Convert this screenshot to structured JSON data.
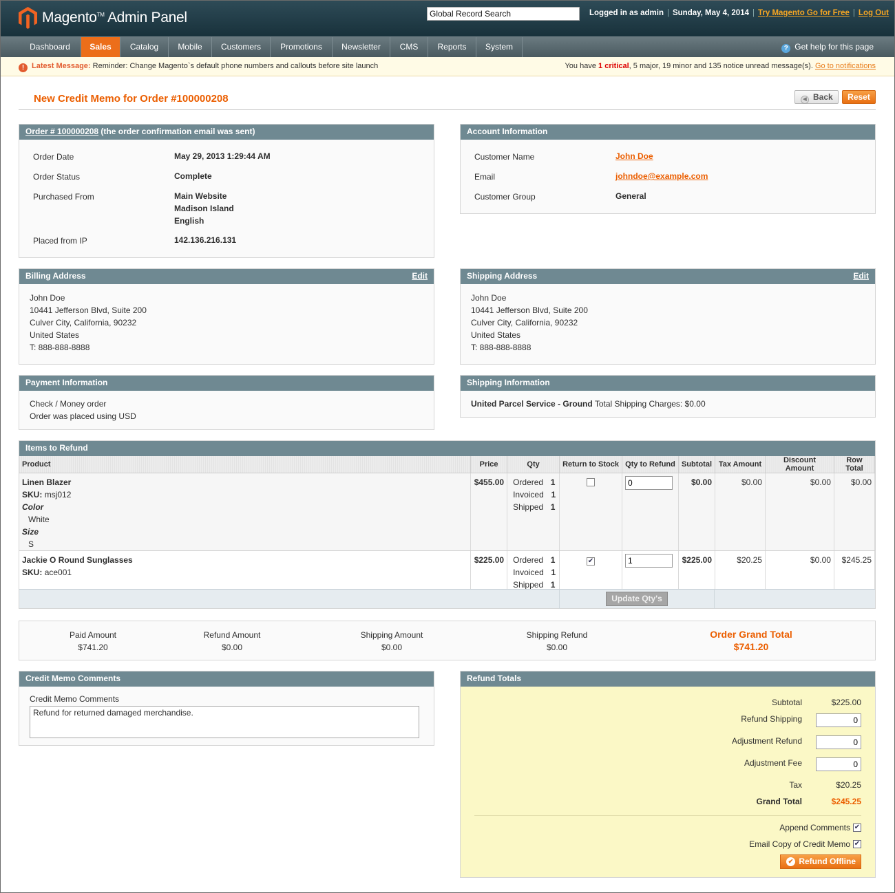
{
  "header": {
    "app_title": "Magento",
    "app_title_tm": "TM",
    "app_subtitle": "Admin Panel",
    "search_value": "Global Record Search",
    "logged_in": "Logged in as admin",
    "date": "Sunday, May 4, 2014",
    "try_link": "Try Magento Go for Free",
    "logout": "Log Out",
    "separator": "|"
  },
  "nav": {
    "items": [
      {
        "label": "Dashboard"
      },
      {
        "label": "Sales",
        "active": true
      },
      {
        "label": "Catalog"
      },
      {
        "label": "Mobile"
      },
      {
        "label": "Customers"
      },
      {
        "label": "Promotions"
      },
      {
        "label": "Newsletter"
      },
      {
        "label": "CMS"
      },
      {
        "label": "Reports"
      },
      {
        "label": "System"
      }
    ],
    "help": "Get help for this page"
  },
  "notice": {
    "label": "Latest Message:",
    "text": "Reminder: Change Magento`s default phone numbers and callouts before site launch",
    "summary_prefix": "You have",
    "critical_count": "1 critical",
    "summary_rest": ", 5 major, 19 minor and 135 notice unread message(s).",
    "link": "Go to notifications"
  },
  "page": {
    "title": "New Credit Memo for Order #100000208",
    "back": "Back",
    "reset": "Reset"
  },
  "order": {
    "link": "Order # 100000208",
    "note": " (the order confirmation email was sent)",
    "date_label": "Order Date",
    "date": "May 29, 2013 1:29:44 AM",
    "status_label": "Order Status",
    "status": "Complete",
    "purchased_label": "Purchased From",
    "purchased": [
      "Main Website",
      "Madison Island",
      "English"
    ],
    "ip_label": "Placed from IP",
    "ip": "142.136.216.131"
  },
  "account": {
    "title": "Account Information",
    "name_label": "Customer Name",
    "name": "John Doe",
    "email_label": "Email",
    "email": "johndoe@example.com",
    "group_label": "Customer Group",
    "group": "General"
  },
  "billing": {
    "title": "Billing Address",
    "edit": "Edit",
    "lines": [
      "John Doe",
      "10441 Jefferson Blvd, Suite 200",
      "Culver City, California, 90232",
      "United States",
      "T: 888-888-8888"
    ]
  },
  "shipping_address": {
    "title": "Shipping Address",
    "edit": "Edit",
    "lines": [
      "John Doe",
      "10441 Jefferson Blvd, Suite 200",
      "Culver City, California, 90232",
      "United States",
      "T: 888-888-8888"
    ]
  },
  "payment": {
    "title": "Payment Information",
    "lines": [
      "Check / Money order",
      "Order was placed using USD"
    ]
  },
  "shipping_info": {
    "title": "Shipping Information",
    "method": "United Parcel Service - Ground",
    "charges": " Total Shipping Charges: $0.00"
  },
  "items": {
    "title": "Items to Refund",
    "columns": [
      "Product",
      "Price",
      "Qty",
      "Return to Stock",
      "Qty to Refund",
      "Subtotal",
      "Tax Amount",
      "Discount Amount",
      "Row Total"
    ],
    "qty_labels": [
      "Ordered",
      "Invoiced",
      "Shipped"
    ],
    "sku_label": "SKU:",
    "rows": [
      {
        "name": "Linen Blazer",
        "sku": "msj012",
        "options": [
          {
            "label": "Color",
            "value": "White"
          },
          {
            "label": "Size",
            "value": "S"
          }
        ],
        "price": "$455.00",
        "qty": [
          "1",
          "1",
          "1"
        ],
        "return_to_stock": false,
        "qty_to_refund": "0",
        "subtotal": "$0.00",
        "tax": "$0.00",
        "discount": "$0.00",
        "row_total": "$0.00"
      },
      {
        "name": "Jackie O Round Sunglasses",
        "sku": "ace001",
        "options": [],
        "price": "$225.00",
        "qty": [
          "1",
          "1",
          "1"
        ],
        "return_to_stock": true,
        "qty_to_refund": "1",
        "subtotal": "$225.00",
        "tax": "$20.25",
        "discount": "$0.00",
        "row_total": "$245.25"
      }
    ],
    "update_button": "Update Qty's"
  },
  "summary": {
    "paid_label": "Paid Amount",
    "paid": "$741.20",
    "refund_label": "Refund Amount",
    "refund": "$0.00",
    "ship_label": "Shipping Amount",
    "ship": "$0.00",
    "ship_refund_label": "Shipping Refund",
    "ship_refund": "$0.00",
    "grand_label": "Order Grand Total",
    "grand": "$741.20"
  },
  "comments": {
    "title": "Credit Memo Comments",
    "field_label": "Credit Memo Comments",
    "value": "Refund for returned damaged merchandise."
  },
  "refund_totals": {
    "title": "Refund Totals",
    "subtotal_label": "Subtotal",
    "subtotal": "$225.00",
    "shipping_label": "Refund Shipping",
    "shipping": "0",
    "adj_refund_label": "Adjustment Refund",
    "adj_refund": "0",
    "adj_fee_label": "Adjustment Fee",
    "adj_fee": "0",
    "tax_label": "Tax",
    "tax": "$20.25",
    "grand_label": "Grand Total",
    "grand": "$245.25",
    "append_label": "Append Comments",
    "append_checked": true,
    "email_label": "Email Copy of Credit Memo",
    "email_checked": true,
    "button": "Refund Offline"
  },
  "colors": {
    "accent": "#eb5e00",
    "header_bg": "#1f3a44",
    "section_head": "#6f8992",
    "refund_bg": "#fbf8c6"
  }
}
